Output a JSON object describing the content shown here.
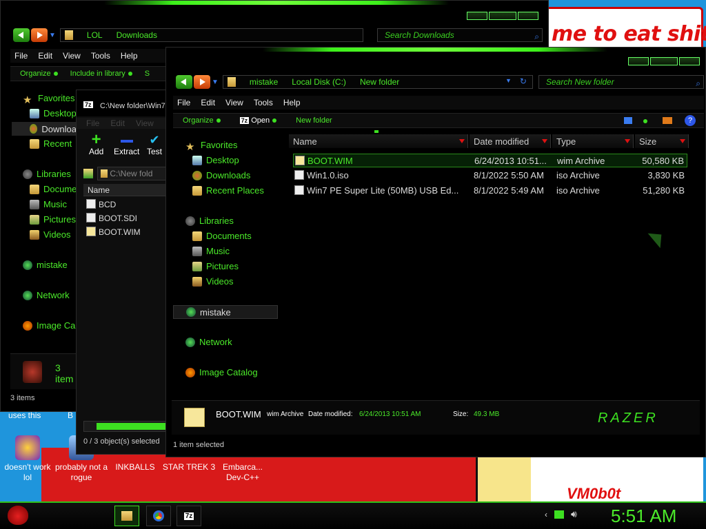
{
  "desktop": {
    "wallpaper_text": "me to eat shit",
    "wallpaper_text2": "VM0b0t",
    "uses_this": "uses this",
    "uses_b": "B",
    "icons": [
      {
        "label": "doesn't work lol"
      },
      {
        "label": "probably not a rogue"
      },
      {
        "label": "INKBALLS"
      },
      {
        "label": "STAR TREK 3"
      },
      {
        "label": "Embarca... Dev-C++"
      }
    ]
  },
  "win1": {
    "breadcrumb": [
      "LOL",
      "Downloads"
    ],
    "search_placeholder": "Search Downloads",
    "menu": [
      "File",
      "Edit",
      "View",
      "Tools",
      "Help"
    ],
    "commands": [
      "Organize",
      "Include in library",
      "S"
    ],
    "nav": [
      "Favorites",
      "Desktop",
      "Downloa",
      "Recent",
      "Libraries",
      "Docume",
      "Music",
      "Pictures",
      "Videos",
      "mistake",
      "Network",
      "Image Ca"
    ],
    "item_count_panel": "3 item",
    "status": "3 items"
  },
  "win2": {
    "title": "C:\\New folder\\Win7",
    "menu": [
      "File",
      "Edit",
      "View"
    ],
    "tools": [
      "Add",
      "Extract",
      "Test"
    ],
    "path": "C:\\New fold",
    "column": "Name",
    "files": [
      "BCD",
      "BOOT.SDI",
      "BOOT.WIM"
    ],
    "status": "0 / 3 object(s) selected"
  },
  "win3": {
    "breadcrumb": [
      "mistake",
      "Local Disk (C:)",
      "New folder"
    ],
    "search_placeholder": "Search New folder",
    "menu": [
      "File",
      "Edit",
      "View",
      "Tools",
      "Help"
    ],
    "commands": {
      "organize": "Organize",
      "open": "Open",
      "new_folder": "New folder"
    },
    "nav": {
      "favorites": "Favorites",
      "desktop": "Desktop",
      "downloads": "Downloads",
      "recent": "Recent Places",
      "libraries": "Libraries",
      "documents": "Documents",
      "music": "Music",
      "pictures": "Pictures",
      "videos": "Videos",
      "mistake": "mistake",
      "network": "Network",
      "image_catalog": "Image Catalog"
    },
    "columns": {
      "name": "Name",
      "date": "Date modified",
      "type": "Type",
      "size": "Size"
    },
    "files": [
      {
        "name": "BOOT.WIM",
        "date": "6/24/2013 10:51...",
        "type": "wim Archive",
        "size": "50,580 KB"
      },
      {
        "name": "Win1.0.iso",
        "date": "8/1/2022 5:50 AM",
        "type": "iso Archive",
        "size": "3,830 KB"
      },
      {
        "name": "Win7 PE Super Lite (50MB) USB Ed...",
        "date": "8/1/2022 5:49 AM",
        "type": "iso Archive",
        "size": "51,280 KB"
      }
    ],
    "details": {
      "name": "BOOT.WIM",
      "type": "wim Archive",
      "date_label": "Date modified:",
      "date": "6/24/2013 10:51 AM",
      "size_label": "Size:",
      "size": "49.3 MB",
      "brand": "RAZER"
    },
    "status": "1 item selected"
  },
  "taskbar": {
    "clock": "5:51 AM",
    "seven_zip_label": "7z"
  },
  "colors": {
    "accent": "#4bea2a",
    "bg": "#000000"
  }
}
